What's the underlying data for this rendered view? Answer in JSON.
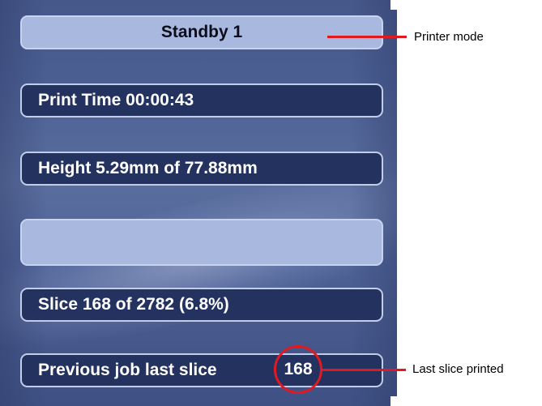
{
  "status": {
    "printer_mode": "Standby 1",
    "print_time": "Print Time 00:00:43",
    "height": "Height 5.29mm of 77.88mm",
    "progress_bar_text": "",
    "slice": "Slice 168 of 2782 (6.8%)",
    "previous_job_label": "Previous job last slice",
    "previous_job_value": "168"
  },
  "annotations": {
    "printer_mode": "Printer mode",
    "last_slice": "Last slice printed"
  },
  "colors": {
    "panel_bg": "#4b5f93",
    "light_field": "#a8b8de",
    "dark_field": "#24325f",
    "callout": "#e11a22"
  }
}
